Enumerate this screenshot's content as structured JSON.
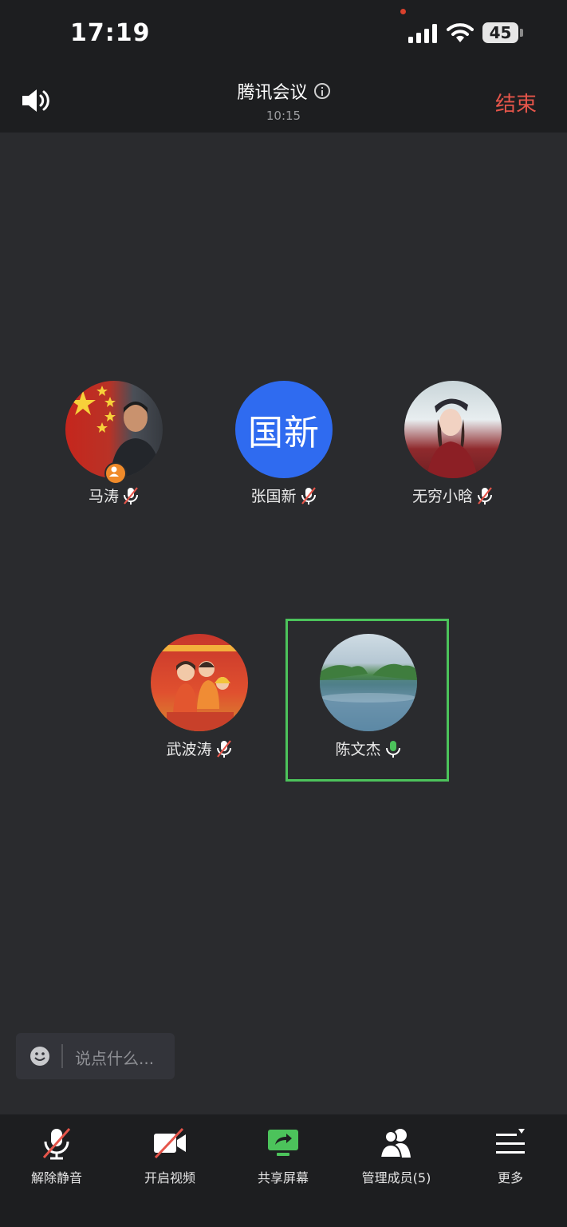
{
  "status_bar": {
    "time": "17:19",
    "battery_level": "45"
  },
  "header": {
    "title": "腾讯会议",
    "timer": "10:15",
    "end_label": "结束",
    "end_color": "#e5554a"
  },
  "participants": [
    {
      "name": "马涛",
      "mic": "muted",
      "is_host": true
    },
    {
      "name": "张国新",
      "mic": "muted",
      "avatar_text": "国新",
      "avatar_color": "#2f6bf0"
    },
    {
      "name": "无穷小晗",
      "mic": "muted"
    },
    {
      "name": "武波涛",
      "mic": "muted"
    },
    {
      "name": "陈文杰",
      "mic": "active",
      "speaking": true,
      "highlight_color": "#4cc35b"
    }
  ],
  "chat": {
    "placeholder": "说点什么..."
  },
  "toolbar": {
    "items": [
      {
        "label": "解除静音",
        "icon": "mic-muted-icon"
      },
      {
        "label": "开启视频",
        "icon": "camera-off-icon"
      },
      {
        "label": "共享屏幕",
        "icon": "share-screen-icon",
        "color": "#4cc35b"
      },
      {
        "label": "管理成员(5)",
        "icon": "members-icon"
      },
      {
        "label": "更多",
        "icon": "more-menu-icon"
      }
    ]
  }
}
